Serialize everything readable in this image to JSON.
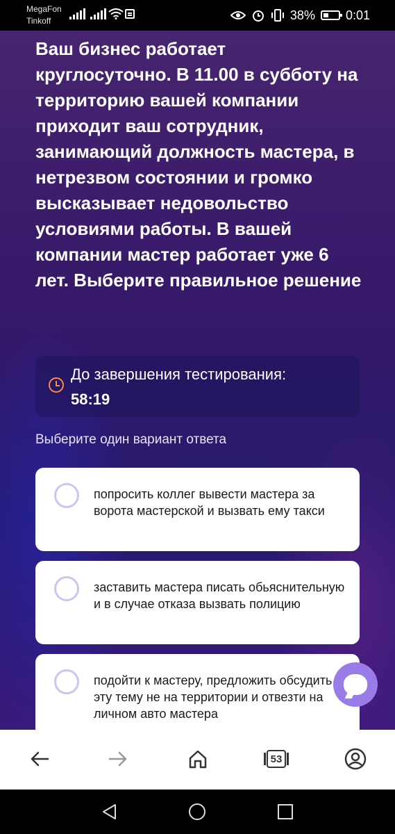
{
  "status_bar": {
    "carrier_1": "MegaFon",
    "carrier_2": "Tinkoff",
    "battery_percent": "38%",
    "time": "0:01"
  },
  "question": {
    "text": "Ваш бизнес работает круглосуточно. В 11.00 в субботу на территорию вашей компании приходит ваш сотрудник, занимающий должность мастера, в нетрезвом состоянии и громко высказывает недовольство условиями работы. В вашей компании мастер работает уже 6 лет. Выберите правильное решение"
  },
  "timer": {
    "label": "До завершения тестирования:",
    "value": "58:19",
    "icon": "clock-icon"
  },
  "instruction": "Выберите один вариант ответа",
  "options": [
    {
      "text": "попросить коллег вывести мастера за ворота мастерской и вызвать ему такси"
    },
    {
      "text": "заставить мастера писать обьяснительную и в случае отказа вызвать полицию"
    },
    {
      "text": "подойти к мастеру, предложить обсудить эту тему не на территории и отвезти на личном авто мастера"
    }
  ],
  "browser_bar": {
    "tabs_count": "53",
    "icons": [
      "back-icon",
      "forward-icon",
      "home-icon",
      "tabs-icon",
      "profile-icon"
    ]
  },
  "colors": {
    "accent": "#9a7ce9",
    "timer_icon": "#ff8a3d",
    "radio_border": "#cfc3f1"
  }
}
